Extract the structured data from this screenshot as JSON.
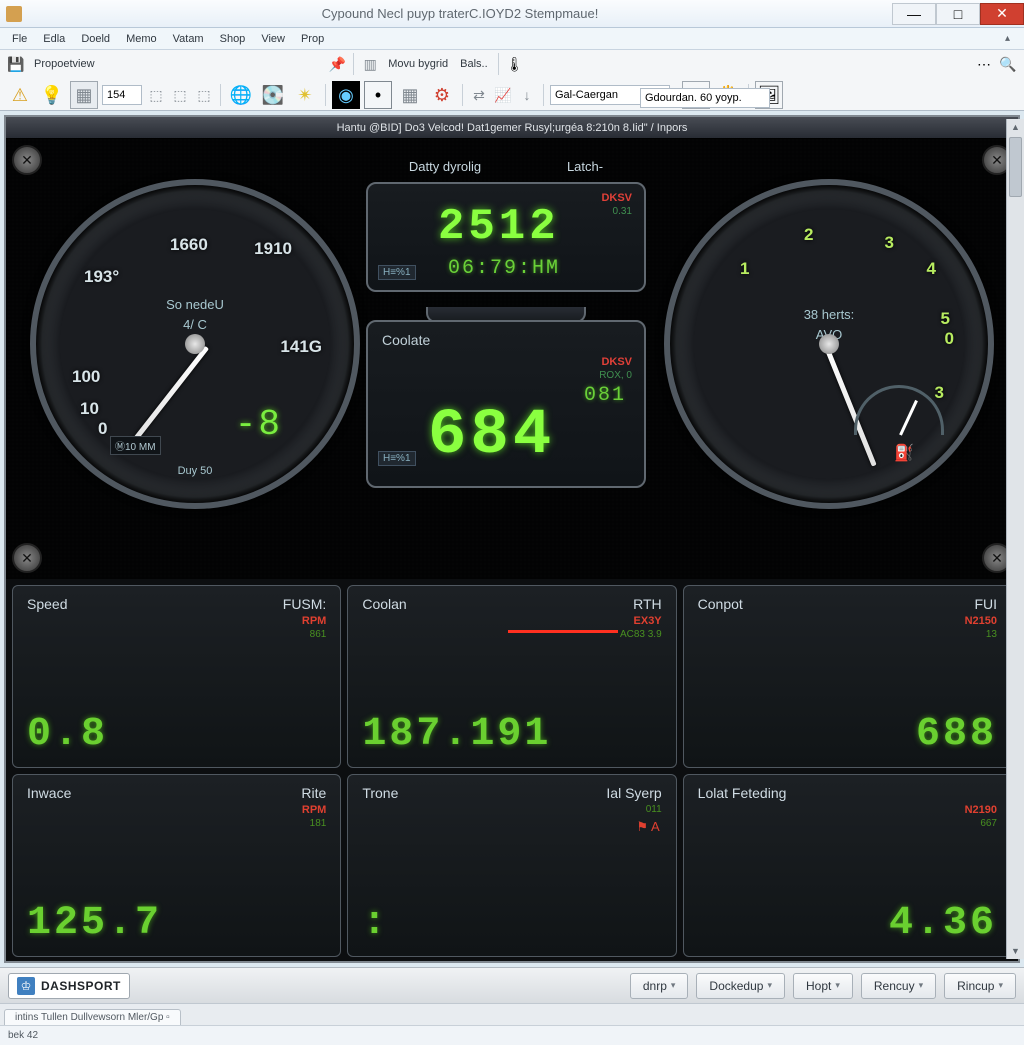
{
  "window": {
    "title": "Cypound Necl puyp traterC.IOYD2 Stempmaue!",
    "min": "—",
    "max": "□",
    "close": "✕"
  },
  "menu": [
    "Fle",
    "Edla",
    "Doeld",
    "Memo",
    "Vatam",
    "Shop",
    "View",
    "Prop"
  ],
  "toolbar": {
    "proport_label": "Propoetview",
    "numeric_value": "154",
    "row2_label1": "Movu bygrid",
    "row2_label2": "Bals..",
    "input1": "Gal-Caergan",
    "input2": "Gdourdan. 60 yoyp.",
    "icons": {
      "pin": "📌",
      "warn": "⚠",
      "sun": "☀",
      "disk": "💾",
      "globe": "🌐",
      "gear": "⚙",
      "spark": "✴",
      "down": "▾",
      "up": "▴",
      "graph": "📈",
      "swap": "⇄",
      "palm": "🖐",
      "frame": "▣",
      "search": "🔍"
    }
  },
  "dash_title": "Hantu @BID] Do3 Velcod! Dat1gemer Rusyl;urgéa 8:210n 8.Iid\" / Inpors",
  "center": {
    "hdr_left": "Datty dyrolig",
    "hdr_right": "Latch-",
    "box1": {
      "tag": "DKSV",
      "sub": "0.31",
      "big": "2512",
      "med": "06:79:HM",
      "side1": "H≡%1",
      "side2": ""
    },
    "box2": {
      "title": "Coolate",
      "tag": "DKSV",
      "sub": "ROX, 0",
      "med": "081",
      "big": "684",
      "side1": "H≡%1"
    }
  },
  "gauge_left": {
    "nums": {
      "n1": "1660",
      "n2": "193°",
      "n3": "1910",
      "n4": "141G",
      "n5": "100",
      "n6": "10",
      "n7": "0"
    },
    "lbl1": "So nedeU",
    "lbl2": "4/ C",
    "digit": "-8",
    "sub": "Ⓜ10 MM",
    "foot": "Duy 50"
  },
  "gauge_right": {
    "nums": {
      "n1": "1",
      "n2": "2",
      "n3": "3",
      "n4": "4",
      "n5": "5",
      "n6": "0",
      "n7": "3"
    },
    "lbl1": "38 herts:",
    "lbl2": "AVO",
    "icon": "⛽"
  },
  "panels": [
    {
      "l": "Speed",
      "r": "FUSM:",
      "unit": "RPM",
      "sub": "861",
      "d": "0.8"
    },
    {
      "l": "Coolan",
      "r": "RTH",
      "unit": "EX3Y",
      "sub": "AC83 3.9",
      "d": "187.191",
      "redline": true
    },
    {
      "l": "Conpot",
      "r": "FUI",
      "unit": "N2150",
      "sub": "13",
      "d": "688"
    },
    {
      "l": "Inwace",
      "r": "Rite",
      "unit": "RPM",
      "sub": "181",
      "d": "125.7"
    },
    {
      "l": "Trone",
      "r": "Ial Syerp",
      "unit": "",
      "sub": "011",
      "d": "  :  ",
      "icon": "⚑ A"
    },
    {
      "l": "Lolat Feteding",
      "r": "",
      "unit": "N2190",
      "sub": "667",
      "d": "4.36"
    }
  ],
  "bottom": {
    "brand": "DASHSPORT",
    "btns": [
      "dnrp",
      "Dockedup",
      "Hopt",
      "Rencuy",
      "Rincup"
    ]
  },
  "status": {
    "tab": "intins Tullen Dullvewsorn Mler/Gp ▫",
    "line": "bek 42"
  }
}
